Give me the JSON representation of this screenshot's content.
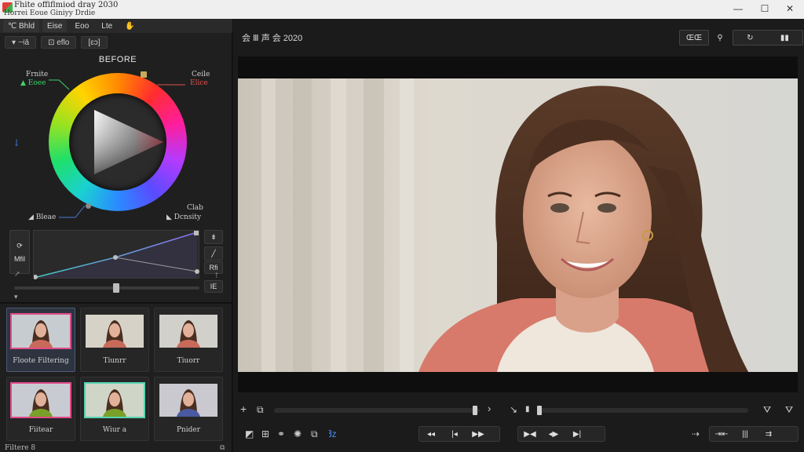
{
  "window": {
    "title": "Fhite offiflmiod dray 2030",
    "subtitle": "Horrei  Eoue Giniyy Drdie",
    "controls": [
      "—",
      "☐",
      "✕"
    ]
  },
  "left_panel": {
    "menu": [
      "℃ Bhld",
      "Eise",
      "Eoo",
      "Lte",
      "✋"
    ],
    "tools": [
      "▾  ⊣ā",
      "⊡ eflo",
      "[ɛɔ]"
    ],
    "section_title": "BEFORE",
    "wheel_labels": {
      "top_left_1": "Frnite",
      "top_left_2": "▲ Eoee",
      "top_right_1": "Ceile",
      "top_right_2": "Elice",
      "left_marker": "↓",
      "bottom_left": "◢ Bleae",
      "bottom_right_1": "Clab",
      "bottom_right_2": "◣ Dcnsity"
    },
    "curve_side": {
      "left_top": "⟳",
      "left_mid": "Mfil",
      "left_bot": "↗",
      "right_top": "⇟",
      "right_mid": "╱",
      "right_bot": "Rfi",
      "right_foot": "⇡"
    },
    "slider": {
      "value_fraction": 0.55,
      "end_button": "IE"
    },
    "collapse_arrow": "▾",
    "filters": [
      {
        "name": "Floote Filtering",
        "style": "pink",
        "selected": true
      },
      {
        "name": "Tiunrr",
        "style": "none",
        "selected": false
      },
      {
        "name": "Tiuorr",
        "style": "none",
        "selected": false
      },
      {
        "name": "Fiitear",
        "style": "pink",
        "selected": false
      },
      {
        "name": "Wiur a",
        "style": "green",
        "selected": false
      },
      {
        "name": "Pnider",
        "style": "none",
        "selected": false
      }
    ],
    "footer": "Filtere 8",
    "footer_icon": "⧉"
  },
  "main": {
    "project_title": "会 Ⅲ 声 会 2020",
    "header_buttons": {
      "view": "ŒŒ",
      "pin": "⚲",
      "loop": "↻",
      "grid": "▮▮"
    },
    "timeline": {
      "left_icons": [
        "+",
        "⧉"
      ],
      "scrub_fraction": 0.978,
      "right_arrow": "›",
      "mid_icons": [
        "↘",
        "▮"
      ],
      "trim_fraction": 0.0,
      "right_icons": [
        "⛛",
        "⛛"
      ]
    },
    "tools": [
      "◩",
      "⊞",
      "⚭",
      "✺",
      "⧉",
      "Ꜣz"
    ],
    "transport_group_1": [
      "◂◂",
      "|◂",
      "▶▶"
    ],
    "transport_group_2": [
      "▶◀",
      "◂▶",
      "▶|"
    ],
    "right_tools": [
      "⇢",
      "⇥⇤",
      "|||",
      "⇉"
    ]
  }
}
